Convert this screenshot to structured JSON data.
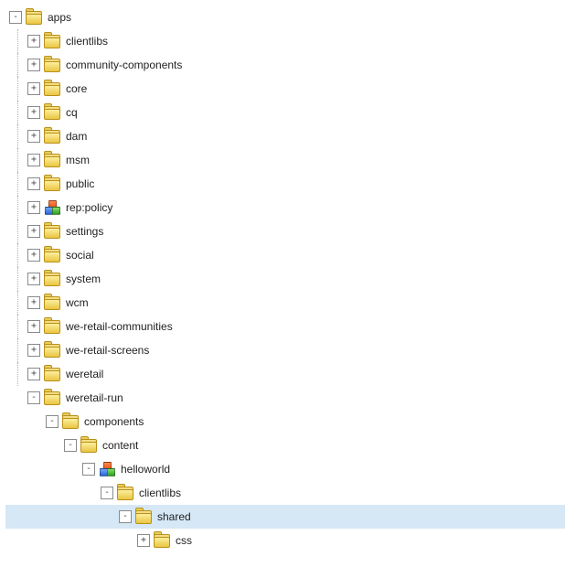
{
  "tree": {
    "root": {
      "label": "apps",
      "icon": "folder",
      "toggle": "-",
      "children": [
        {
          "label": "clientlibs",
          "icon": "folder",
          "toggle": "+"
        },
        {
          "label": "community-components",
          "icon": "folder",
          "toggle": "+"
        },
        {
          "label": "core",
          "icon": "folder",
          "toggle": "+"
        },
        {
          "label": "cq",
          "icon": "folder",
          "toggle": "+"
        },
        {
          "label": "dam",
          "icon": "folder",
          "toggle": "+"
        },
        {
          "label": "msm",
          "icon": "folder",
          "toggle": "+"
        },
        {
          "label": "public",
          "icon": "folder",
          "toggle": "+"
        },
        {
          "label": "rep:policy",
          "icon": "cubes",
          "toggle": "+"
        },
        {
          "label": "settings",
          "icon": "folder",
          "toggle": "+"
        },
        {
          "label": "social",
          "icon": "folder",
          "toggle": "+"
        },
        {
          "label": "system",
          "icon": "folder",
          "toggle": "+"
        },
        {
          "label": "wcm",
          "icon": "folder",
          "toggle": "+"
        },
        {
          "label": "we-retail-communities",
          "icon": "folder",
          "toggle": "+"
        },
        {
          "label": "we-retail-screens",
          "icon": "folder",
          "toggle": "+"
        },
        {
          "label": "weretail",
          "icon": "folder",
          "toggle": "+"
        },
        {
          "label": "weretail-run",
          "icon": "folder",
          "toggle": "-",
          "children": [
            {
              "label": "components",
              "icon": "folder",
              "toggle": "-",
              "children": [
                {
                  "label": "content",
                  "icon": "folder",
                  "toggle": "-",
                  "children": [
                    {
                      "label": "helloworld",
                      "icon": "cubes",
                      "toggle": "-",
                      "children": [
                        {
                          "label": "clientlibs",
                          "icon": "folder",
                          "toggle": "-",
                          "children": [
                            {
                              "label": "shared",
                              "icon": "folder",
                              "toggle": "-",
                              "selected": true,
                              "children": [
                                {
                                  "label": "css",
                                  "icon": "folder",
                                  "toggle": "+"
                                }
                              ]
                            }
                          ]
                        }
                      ]
                    }
                  ]
                }
              ]
            }
          ]
        }
      ]
    }
  },
  "toggle_glyphs": {
    "expand": "+",
    "collapse": "-"
  }
}
